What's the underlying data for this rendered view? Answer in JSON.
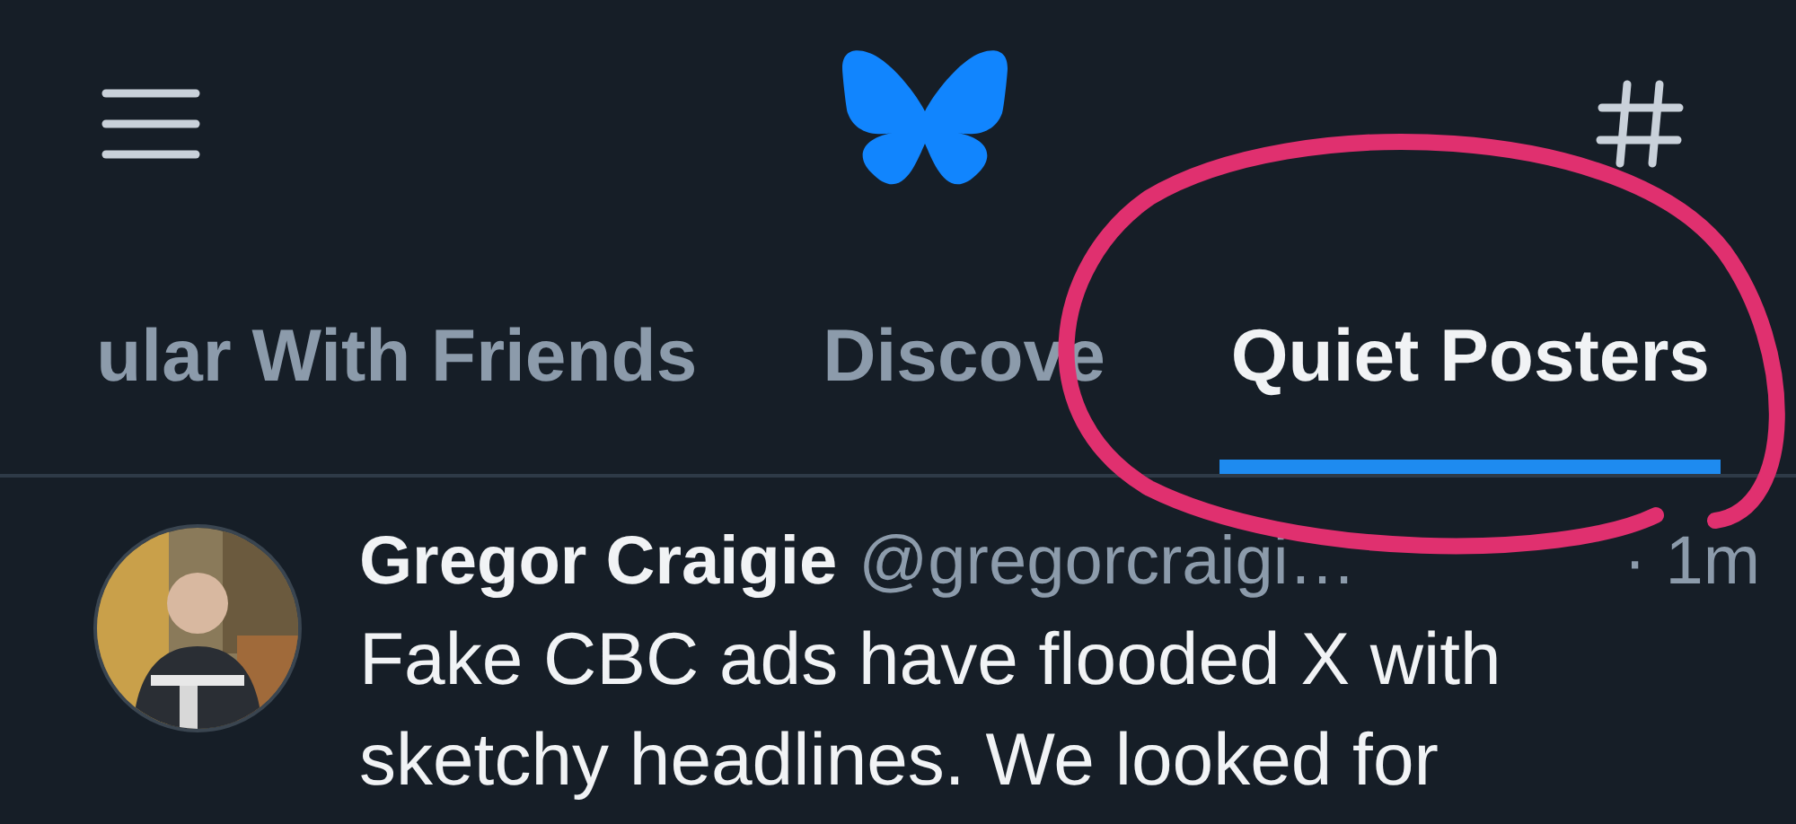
{
  "tabs": [
    {
      "label": "ular With Friends",
      "selected": false
    },
    {
      "label": "Discove",
      "selected": false
    },
    {
      "label": "Quiet Posters",
      "selected": true
    }
  ],
  "post": {
    "author": "Gregor Craigie",
    "handle": "@gregorcraigi…",
    "time": "· 1m",
    "text": "Fake CBC ads have flooded X with sketchy headlines. We looked for"
  }
}
